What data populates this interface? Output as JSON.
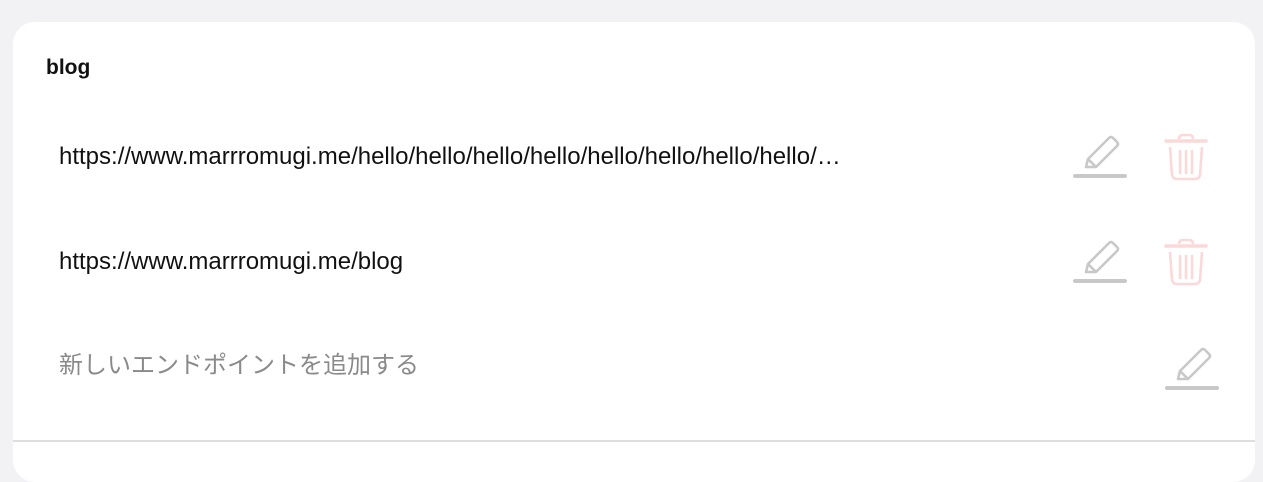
{
  "group": {
    "title": "blog"
  },
  "endpoints": [
    {
      "url": "https://www.marrromugi.me/hello/hello/hello/hello/hello/hello/hello/hello/…",
      "edit_icon": "pencil-icon",
      "delete_icon": "trash-icon"
    },
    {
      "url": "https://www.marrromugi.me/blog",
      "edit_icon": "pencil-icon",
      "delete_icon": "trash-icon"
    }
  ],
  "new_endpoint": {
    "placeholder": "新しいエンドポイントを追加する",
    "value": "",
    "edit_icon": "pencil-icon"
  },
  "colors": {
    "background": "#f2f2f4",
    "card": "#ffffff",
    "icon_gray": "#c8c8c8",
    "icon_red_disabled": "#fbd9d9",
    "divider": "#dedede"
  }
}
